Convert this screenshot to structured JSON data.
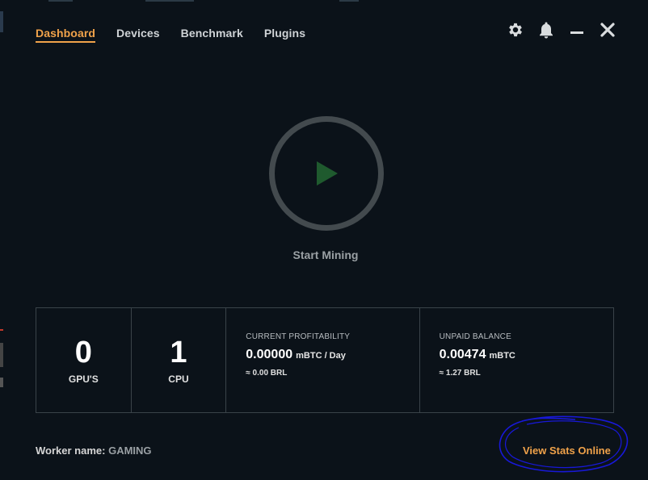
{
  "nav": {
    "tabs": [
      {
        "label": "Dashboard",
        "active": true
      },
      {
        "label": "Devices",
        "active": false
      },
      {
        "label": "Benchmark",
        "active": false
      },
      {
        "label": "Plugins",
        "active": false
      }
    ]
  },
  "controls": {
    "icons": [
      "gear-icon",
      "bell-icon",
      "minimize-icon",
      "close-icon"
    ]
  },
  "start": {
    "label": "Start Mining",
    "icon": "play-icon"
  },
  "stats": {
    "gpus": {
      "value": "0",
      "label": "GPU'S"
    },
    "cpus": {
      "value": "1",
      "label": "CPU"
    },
    "profitability": {
      "title": "CURRENT PROFITABILITY",
      "value": "0.00000",
      "unit": "mBTC / Day",
      "sub": "≈ 0.00 BRL"
    },
    "balance": {
      "title": "UNPAID BALANCE",
      "value": "0.00474",
      "unit": "mBTC",
      "sub": "≈ 1.27 BRL"
    }
  },
  "footer": {
    "worker_label": "Worker name:",
    "worker_value": "GAMING",
    "view_stats": "View Stats Online"
  },
  "colors": {
    "background": "#0b1219",
    "accent": "#f0a24a",
    "play": "#1f5a2e",
    "ring": "#434a4e",
    "annotation": "#1818d8"
  }
}
